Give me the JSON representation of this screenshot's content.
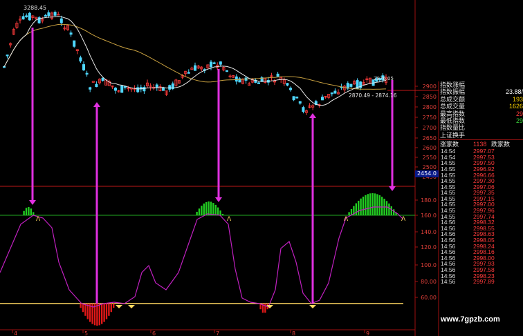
{
  "chart_data": [
    {
      "type": "candlestick",
      "title": "",
      "price_axis": {
        "ticks": [
          "2900",
          "2850",
          "2800",
          "2750",
          "2700",
          "2650",
          "2600",
          "2550",
          "2500",
          "2450"
        ],
        "ylim": [
          2430,
          3300
        ]
      },
      "annotations": {
        "high_label": "3288.45",
        "range_label": "2870.49 - 2874.16",
        "price_tag": "2454.0",
        "top_right_label": "2876.05"
      },
      "ma_lines": [
        "short",
        "long"
      ]
    },
    {
      "type": "line",
      "title": "",
      "indicator_axis": {
        "ticks": [
          "180.0",
          "160.0",
          "140.0",
          "120.0",
          "100.0",
          "80.00",
          "60.00"
        ],
        "ylim": [
          50,
          190
        ]
      },
      "reference_levels": [
        160,
        55
      ]
    }
  ],
  "x_axis": {
    "ticks": [
      "4",
      "5",
      "6",
      "7",
      "8",
      "9"
    ]
  },
  "panel": {
    "stats": [
      {
        "label": "指数涨幅",
        "value": "",
        "color": "#ffd500"
      },
      {
        "label": "指数振幅",
        "value": "23.88/",
        "color": "#ffffff"
      },
      {
        "label": "总成交额",
        "value": "193",
        "color": "#ffd500"
      },
      {
        "label": "总成交量",
        "value": "1626",
        "color": "#ffd500"
      },
      {
        "label": "最高指数",
        "value": "29",
        "color": "#ff3b3b"
      },
      {
        "label": "最低指数",
        "value": "29",
        "color": "#3cd83c"
      },
      {
        "label": "指数量比",
        "value": "",
        "color": "#ffffff"
      },
      {
        "label": "上证换手",
        "value": "",
        "color": "#ffffff"
      }
    ],
    "rise_label": "涨家数",
    "rise_value": "1138",
    "fall_label": "跌家数",
    "ticks": [
      {
        "time": "14:54",
        "price": "2997.07"
      },
      {
        "time": "14:54",
        "price": "2997.53"
      },
      {
        "time": "14:55",
        "price": "2997.50"
      },
      {
        "time": "14:55",
        "price": "2996.92"
      },
      {
        "time": "14:55",
        "price": "2996.66"
      },
      {
        "time": "14:55",
        "price": "2997.30"
      },
      {
        "time": "14:55",
        "price": "2997.06"
      },
      {
        "time": "14:55",
        "price": "2997.35"
      },
      {
        "time": "14:55",
        "price": "2997.15"
      },
      {
        "time": "14:55",
        "price": "2997.00"
      },
      {
        "time": "14:55",
        "price": "2997.96"
      },
      {
        "time": "14:55",
        "price": "2997.74"
      },
      {
        "time": "14:56",
        "price": "2998.32"
      },
      {
        "time": "14:56",
        "price": "2998.55"
      },
      {
        "time": "14:56",
        "price": "2998.63"
      },
      {
        "time": "14:56",
        "price": "2998.05"
      },
      {
        "time": "14:56",
        "price": "2998.24"
      },
      {
        "time": "14:56",
        "price": "2998.16"
      },
      {
        "time": "14:56",
        "price": "2998.00"
      },
      {
        "time": "14:56",
        "price": "2997.93"
      },
      {
        "time": "14:56",
        "price": "2997.58"
      },
      {
        "time": "14:56",
        "price": "2998.23"
      },
      {
        "time": "14:56",
        "price": "2997.89"
      }
    ]
  },
  "watermark": "www.7gpzb.com",
  "colors": {
    "up": "#ff3b3b",
    "down": "#4fd8ff",
    "magenta": "#e030e0",
    "green": "#22cc22",
    "yellow": "#ffd860",
    "red_line": "#c01818",
    "green_line": "#22aa22"
  }
}
